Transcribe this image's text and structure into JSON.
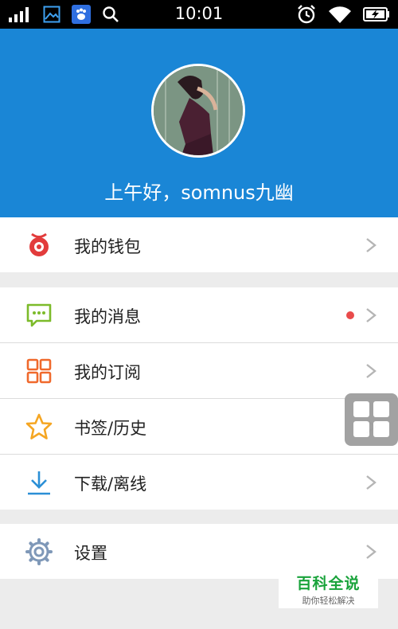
{
  "status_bar": {
    "time": "10:01"
  },
  "header": {
    "greeting": "上午好，somnus九幽"
  },
  "menu": {
    "wallet": "我的钱包",
    "messages": "我的消息",
    "subscriptions": "我的订阅",
    "bookmarks": "书签/历史",
    "downloads": "下载/离线",
    "settings": "设置"
  },
  "watermark": {
    "title": "百科全说",
    "subtitle": "助你轻松解决"
  },
  "colors": {
    "header_bg": "#1a86d6",
    "wallet_icon": "#e23c3c",
    "messages_icon": "#7cbb2a",
    "subscriptions_icon": "#f0692c",
    "bookmarks_icon": "#f5a623",
    "downloads_icon": "#2b8fd6",
    "settings_icon": "#7f98b8",
    "unread_dot": "#e94b4b"
  },
  "icons": {
    "wallet": "wallet-icon",
    "messages": "chat-bubble-icon",
    "subscriptions": "grid-icon",
    "bookmarks": "star-icon",
    "downloads": "download-icon",
    "settings": "gear-icon"
  }
}
